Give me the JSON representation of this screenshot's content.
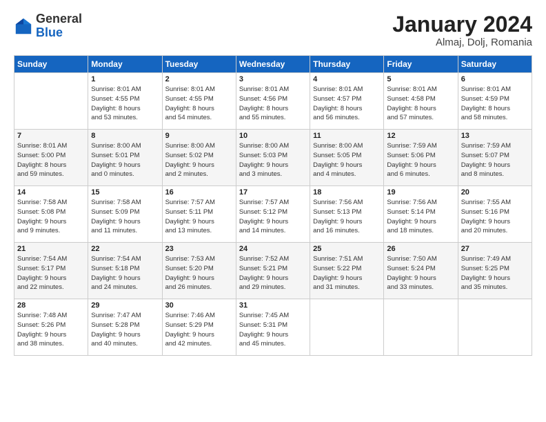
{
  "header": {
    "logo_general": "General",
    "logo_blue": "Blue",
    "month_title": "January 2024",
    "subtitle": "Almaj, Dolj, Romania"
  },
  "days_of_week": [
    "Sunday",
    "Monday",
    "Tuesday",
    "Wednesday",
    "Thursday",
    "Friday",
    "Saturday"
  ],
  "weeks": [
    [
      {
        "day": "",
        "content": ""
      },
      {
        "day": "1",
        "content": "Sunrise: 8:01 AM\nSunset: 4:55 PM\nDaylight: 8 hours\nand 53 minutes."
      },
      {
        "day": "2",
        "content": "Sunrise: 8:01 AM\nSunset: 4:55 PM\nDaylight: 8 hours\nand 54 minutes."
      },
      {
        "day": "3",
        "content": "Sunrise: 8:01 AM\nSunset: 4:56 PM\nDaylight: 8 hours\nand 55 minutes."
      },
      {
        "day": "4",
        "content": "Sunrise: 8:01 AM\nSunset: 4:57 PM\nDaylight: 8 hours\nand 56 minutes."
      },
      {
        "day": "5",
        "content": "Sunrise: 8:01 AM\nSunset: 4:58 PM\nDaylight: 8 hours\nand 57 minutes."
      },
      {
        "day": "6",
        "content": "Sunrise: 8:01 AM\nSunset: 4:59 PM\nDaylight: 8 hours\nand 58 minutes."
      }
    ],
    [
      {
        "day": "7",
        "content": "Sunrise: 8:01 AM\nSunset: 5:00 PM\nDaylight: 8 hours\nand 59 minutes."
      },
      {
        "day": "8",
        "content": "Sunrise: 8:00 AM\nSunset: 5:01 PM\nDaylight: 9 hours\nand 0 minutes."
      },
      {
        "day": "9",
        "content": "Sunrise: 8:00 AM\nSunset: 5:02 PM\nDaylight: 9 hours\nand 2 minutes."
      },
      {
        "day": "10",
        "content": "Sunrise: 8:00 AM\nSunset: 5:03 PM\nDaylight: 9 hours\nand 3 minutes."
      },
      {
        "day": "11",
        "content": "Sunrise: 8:00 AM\nSunset: 5:05 PM\nDaylight: 9 hours\nand 4 minutes."
      },
      {
        "day": "12",
        "content": "Sunrise: 7:59 AM\nSunset: 5:06 PM\nDaylight: 9 hours\nand 6 minutes."
      },
      {
        "day": "13",
        "content": "Sunrise: 7:59 AM\nSunset: 5:07 PM\nDaylight: 9 hours\nand 8 minutes."
      }
    ],
    [
      {
        "day": "14",
        "content": "Sunrise: 7:58 AM\nSunset: 5:08 PM\nDaylight: 9 hours\nand 9 minutes."
      },
      {
        "day": "15",
        "content": "Sunrise: 7:58 AM\nSunset: 5:09 PM\nDaylight: 9 hours\nand 11 minutes."
      },
      {
        "day": "16",
        "content": "Sunrise: 7:57 AM\nSunset: 5:11 PM\nDaylight: 9 hours\nand 13 minutes."
      },
      {
        "day": "17",
        "content": "Sunrise: 7:57 AM\nSunset: 5:12 PM\nDaylight: 9 hours\nand 14 minutes."
      },
      {
        "day": "18",
        "content": "Sunrise: 7:56 AM\nSunset: 5:13 PM\nDaylight: 9 hours\nand 16 minutes."
      },
      {
        "day": "19",
        "content": "Sunrise: 7:56 AM\nSunset: 5:14 PM\nDaylight: 9 hours\nand 18 minutes."
      },
      {
        "day": "20",
        "content": "Sunrise: 7:55 AM\nSunset: 5:16 PM\nDaylight: 9 hours\nand 20 minutes."
      }
    ],
    [
      {
        "day": "21",
        "content": "Sunrise: 7:54 AM\nSunset: 5:17 PM\nDaylight: 9 hours\nand 22 minutes."
      },
      {
        "day": "22",
        "content": "Sunrise: 7:54 AM\nSunset: 5:18 PM\nDaylight: 9 hours\nand 24 minutes."
      },
      {
        "day": "23",
        "content": "Sunrise: 7:53 AM\nSunset: 5:20 PM\nDaylight: 9 hours\nand 26 minutes."
      },
      {
        "day": "24",
        "content": "Sunrise: 7:52 AM\nSunset: 5:21 PM\nDaylight: 9 hours\nand 29 minutes."
      },
      {
        "day": "25",
        "content": "Sunrise: 7:51 AM\nSunset: 5:22 PM\nDaylight: 9 hours\nand 31 minutes."
      },
      {
        "day": "26",
        "content": "Sunrise: 7:50 AM\nSunset: 5:24 PM\nDaylight: 9 hours\nand 33 minutes."
      },
      {
        "day": "27",
        "content": "Sunrise: 7:49 AM\nSunset: 5:25 PM\nDaylight: 9 hours\nand 35 minutes."
      }
    ],
    [
      {
        "day": "28",
        "content": "Sunrise: 7:48 AM\nSunset: 5:26 PM\nDaylight: 9 hours\nand 38 minutes."
      },
      {
        "day": "29",
        "content": "Sunrise: 7:47 AM\nSunset: 5:28 PM\nDaylight: 9 hours\nand 40 minutes."
      },
      {
        "day": "30",
        "content": "Sunrise: 7:46 AM\nSunset: 5:29 PM\nDaylight: 9 hours\nand 42 minutes."
      },
      {
        "day": "31",
        "content": "Sunrise: 7:45 AM\nSunset: 5:31 PM\nDaylight: 9 hours\nand 45 minutes."
      },
      {
        "day": "",
        "content": ""
      },
      {
        "day": "",
        "content": ""
      },
      {
        "day": "",
        "content": ""
      }
    ]
  ]
}
